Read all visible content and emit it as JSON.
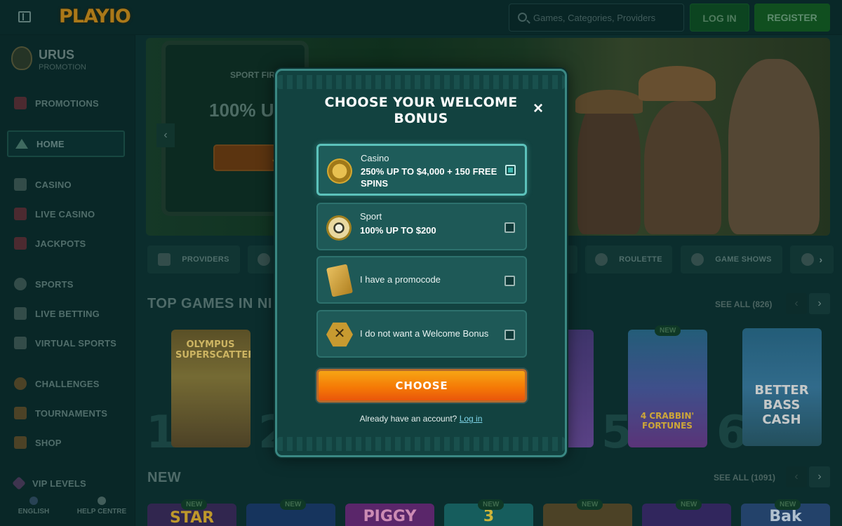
{
  "header": {
    "logo": "PLAYIO",
    "search_placeholder": "Games, Categories, Providers",
    "login_label": "LOG IN",
    "register_label": "REGISTER"
  },
  "sidebar": {
    "brand_title": "URUS",
    "brand_subtitle": "PROMOTION",
    "items": [
      {
        "label": "PROMOTIONS",
        "icon": "gift-icon"
      },
      {
        "label": "HOME",
        "icon": "home-icon"
      },
      {
        "label": "CASINO",
        "icon": "slot-icon"
      },
      {
        "label": "LIVE CASINO",
        "icon": "cards-icon"
      },
      {
        "label": "JACKPOTS",
        "icon": "clover-icon"
      },
      {
        "label": "SPORTS",
        "icon": "ball-icon"
      },
      {
        "label": "LIVE BETTING",
        "icon": "live-icon"
      },
      {
        "label": "VIRTUAL SPORTS",
        "icon": "gamepad-icon"
      },
      {
        "label": "CHALLENGES",
        "icon": "target-icon"
      },
      {
        "label": "TOURNAMENTS",
        "icon": "trophy-icon"
      },
      {
        "label": "SHOP",
        "icon": "bag-icon"
      },
      {
        "label": "VIP LEVELS",
        "icon": "diamond-icon"
      }
    ],
    "footer": {
      "language": "ENGLISH",
      "help": "HELP CENTRE"
    }
  },
  "hero": {
    "caption": "SPORT FIR",
    "title": "100% U",
    "button": "J"
  },
  "categories": [
    "PROVIDERS",
    "ROULETTE",
    "GAME SHOWS"
  ],
  "sections": {
    "top_games_title": "TOP GAMES IN NI",
    "top_games_see_all": "SEE ALL (826)",
    "new_title": "NEW",
    "new_see_all": "SEE ALL (1091)"
  },
  "top_games": [
    {
      "rank": "1",
      "title": "OLYMPUS SUPERSCATTER"
    },
    {
      "rank": "2",
      "title": ""
    },
    {
      "rank": "5",
      "title": "4 CRABBIN' FORTUNES",
      "badge": "NEW"
    },
    {
      "rank": "6",
      "title": "BETTER BASS CASH"
    }
  ],
  "new_badge": "NEW",
  "new_row": [
    "STAR",
    "",
    "PIGGY",
    "3",
    "",
    "",
    "Bak"
  ],
  "modal": {
    "title": "CHOOSE YOUR WELCOME BONUS",
    "close": "×",
    "options": [
      {
        "label": "Casino",
        "detail": "250% UP TO $4,000 + 150 FREE SPINS",
        "icon": "clover-coin-icon",
        "selected": true
      },
      {
        "label": "Sport",
        "detail": "100% UP TO $200",
        "icon": "soccer-ball-icon",
        "selected": false
      },
      {
        "label": "I have a promocode",
        "icon": "ticket-icon",
        "selected": false
      },
      {
        "label": "I do not want a Welcome Bonus",
        "icon": "x-badge-icon",
        "selected": false
      }
    ],
    "choose_label": "CHOOSE",
    "account_text": "Already have an account?",
    "login_link": "Log in"
  },
  "colors": {
    "background": "#0d3232",
    "modal_bg": "#124240",
    "accent_teal": "#5cc2bb",
    "choose_orange": "#f57a06",
    "link": "#7fd6e9"
  }
}
